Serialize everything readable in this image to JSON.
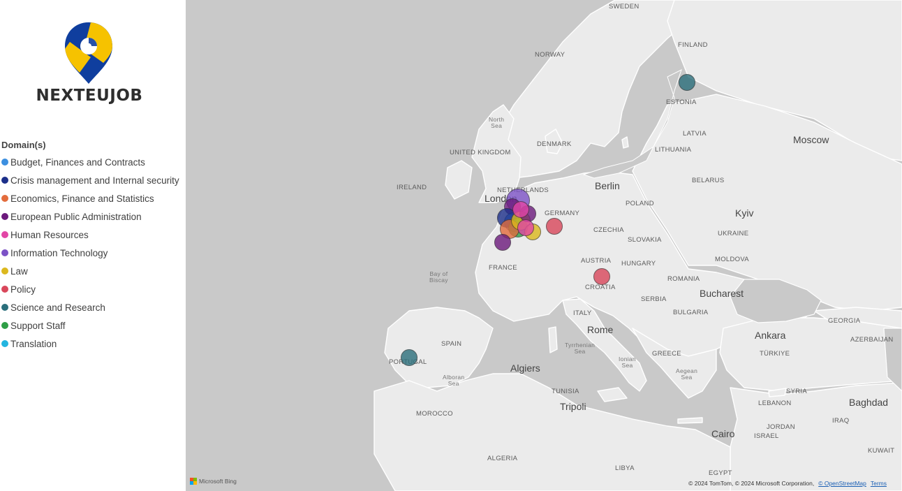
{
  "brand": {
    "name": "NEXTEUJOB",
    "colors": {
      "blue": "#0f3e9e",
      "yellow": "#f6c200"
    }
  },
  "legend": {
    "title": "Domain(s)",
    "items": [
      {
        "label": "Budget, Finances and Contracts",
        "color": "#3c8fe0"
      },
      {
        "label": "Crisis management and Internal security",
        "color": "#1c2f8a"
      },
      {
        "label": "Economics, Finance and Statistics",
        "color": "#e36c3d"
      },
      {
        "label": "European Public Administration",
        "color": "#6c1a7c"
      },
      {
        "label": "Human Resources",
        "color": "#e246a6"
      },
      {
        "label": "Information Technology",
        "color": "#7c52c6"
      },
      {
        "label": "Law",
        "color": "#dcb81e"
      },
      {
        "label": "Policy",
        "color": "#d9475b"
      },
      {
        "label": "Science and Research",
        "color": "#2b6f7b"
      },
      {
        "label": "Support Staff",
        "color": "#2e9e46"
      },
      {
        "label": "Translation",
        "color": "#23b5e0"
      }
    ]
  },
  "map": {
    "country_labels": [
      "SWEDEN",
      "NORWAY",
      "FINLAND",
      "ESTONIA",
      "LATVIA",
      "LITHUANIA",
      "DENMARK",
      "UNITED KINGDOM",
      "IRELAND",
      "NETHERLANDS",
      "GERMANY",
      "POLAND",
      "BELARUS",
      "CZECHIA",
      "SLOVAKIA",
      "UKRAINE",
      "MOLDOVA",
      "AUSTRIA",
      "HUNGARY",
      "ROMANIA",
      "FRANCE",
      "CROATIA",
      "SERBIA",
      "BULGARIA",
      "ITALY",
      "GREECE",
      "SPAIN",
      "PORTUGAL",
      "TÜRKIYE",
      "GEORGIA",
      "AZERBAIJAN",
      "SYRIA",
      "LEBANON",
      "ISRAEL",
      "JORDAN",
      "IRAQ",
      "KUWAIT",
      "MOROCCO",
      "ALGERIA",
      "TUNISIA",
      "LIBYA",
      "EGYPT"
    ],
    "city_labels": [
      "Moscow",
      "Berlin",
      "Kyiv",
      "London",
      "Bucharest",
      "Rome",
      "Ankara",
      "Algiers",
      "Tripoli",
      "Baghdad",
      "Cairo"
    ],
    "sea_labels": [
      "North Sea",
      "Bay of Biscay",
      "Tyrrhenian Sea",
      "Ionian Sea",
      "Aegean Sea",
      "Alboran Sea"
    ],
    "points": [
      {
        "place": "Helsinki",
        "domain": "Science and Research"
      },
      {
        "place": "Lisbon",
        "domain": "Science and Research"
      },
      {
        "place": "Amsterdam",
        "domain": "Information Technology"
      },
      {
        "place": "The Hague",
        "domain": "European Public Administration"
      },
      {
        "place": "Brussels",
        "domain": "Budget, Finances and Contracts"
      },
      {
        "place": "Brussels",
        "domain": "Crisis management and Internal security"
      },
      {
        "place": "Brussels",
        "domain": "Support Staff"
      },
      {
        "place": "Brussels",
        "domain": "Economics, Finance and Statistics"
      },
      {
        "place": "Brussels",
        "domain": "Law"
      },
      {
        "place": "Cologne",
        "domain": "European Public Administration"
      },
      {
        "place": "Cologne",
        "domain": "Human Resources"
      },
      {
        "place": "Luxembourg",
        "domain": "Law"
      },
      {
        "place": "Luxembourg",
        "domain": "Human Resources"
      },
      {
        "place": "Frankfurt",
        "domain": "Policy"
      },
      {
        "place": "Paris",
        "domain": "European Public Administration"
      },
      {
        "place": "Ljubljana",
        "domain": "Policy"
      }
    ]
  },
  "footer": {
    "provider": "Microsoft Bing",
    "attribution": "© 2024 TomTom, © 2024 Microsoft Corporation,",
    "osm_link": "© OpenStreetMap",
    "terms_link": "Terms"
  }
}
